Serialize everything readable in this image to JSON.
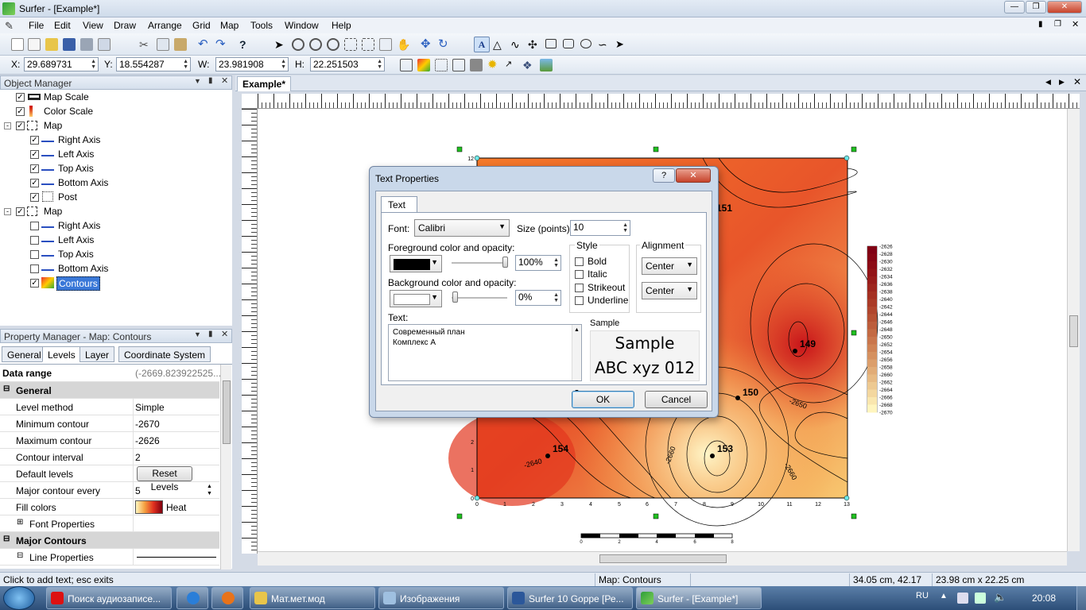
{
  "window": {
    "title": "Surfer - [Example*]"
  },
  "menu": [
    "File",
    "Edit",
    "View",
    "Draw",
    "Arrange",
    "Grid",
    "Map",
    "Tools",
    "Window",
    "Help"
  ],
  "coords": {
    "x_label": "X:",
    "x": "29.689731",
    "y_label": "Y:",
    "y": "18.554287",
    "w_label": "W:",
    "w": "23.981908",
    "h_label": "H:",
    "h": "22.251503"
  },
  "object_manager": {
    "title": "Object Manager",
    "items": [
      "Map Scale",
      "Color Scale",
      "Map",
      "Right Axis",
      "Left Axis",
      "Top Axis",
      "Bottom Axis",
      "Post",
      "Map",
      "Right Axis",
      "Left Axis",
      "Top Axis",
      "Bottom Axis",
      "Contours"
    ]
  },
  "property_manager": {
    "title": "Property Manager - Map: Contours",
    "tabs": [
      "General",
      "Levels",
      "Layer",
      "Coordinate System"
    ],
    "data_range_label": "Data range",
    "data_range": "(-2669.823922525...",
    "general": "General",
    "rows": [
      {
        "k": "Level method",
        "v": "Simple"
      },
      {
        "k": "Minimum contour",
        "v": "-2670"
      },
      {
        "k": "Maximum contour",
        "v": "-2626"
      },
      {
        "k": "Contour interval",
        "v": "2"
      },
      {
        "k": "Default levels",
        "v": "Reset Levels"
      },
      {
        "k": "Major contour every",
        "v": "5"
      },
      {
        "k": "Fill colors",
        "v": "Heat"
      },
      {
        "k": "Font Properties",
        "v": ""
      }
    ],
    "major": "Major Contours",
    "line_props": "Line Properties"
  },
  "doc": {
    "tab": "Example*"
  },
  "map": {
    "x_ticks": [
      "0",
      "1",
      "2",
      "3",
      "4",
      "5",
      "6",
      "7",
      "8",
      "9",
      "10",
      "11",
      "12",
      "13"
    ],
    "y_ticks": [
      "0",
      "1",
      "2",
      "12"
    ],
    "labels": [
      {
        "t": "151"
      },
      {
        "t": "149"
      },
      {
        "t": "150"
      },
      {
        "t": "154"
      },
      {
        "t": "153"
      }
    ],
    "contour_labels": [
      "-2650",
      "-2640",
      "-2660",
      "-2660"
    ],
    "scale_ticks": [
      "0",
      "2",
      "4",
      "6",
      "8"
    ],
    "colorscale": [
      "-2626",
      "-2628",
      "-2630",
      "-2632",
      "-2634",
      "-2636",
      "-2638",
      "-2640",
      "-2642",
      "-2644",
      "-2646",
      "-2648",
      "-2650",
      "-2652",
      "-2654",
      "-2656",
      "-2658",
      "-2660",
      "-2662",
      "-2664",
      "-2666",
      "-2668",
      "-2670"
    ]
  },
  "dialog": {
    "title": "Text Properties",
    "tab": "Text",
    "font_label": "Font:",
    "font": "Calibri",
    "size_label": "Size (points):",
    "size": "10",
    "fg_label": "Foreground color and opacity:",
    "fg_opacity": "100%",
    "bg_label": "Background color and opacity:",
    "bg_opacity": "0%",
    "style_label": "Style",
    "styles": [
      "Bold",
      "Italic",
      "Strikeout",
      "Underline"
    ],
    "alignment_label": "Alignment",
    "align_h": "Center",
    "align_v": "Center",
    "text_label": "Text:",
    "text_line1": "Современный план",
    "text_line2": "Комплекс А",
    "sample_label": "Sample",
    "sample_line1": "Sample",
    "sample_line2": "ABC xyz 012",
    "ok": "OK",
    "cancel": "Cancel"
  },
  "status": {
    "hint": "Click to add text; esc exits",
    "selection": "Map: Contours",
    "pos": "34.05 cm, 42.17 cm",
    "size": "23.98 cm x 22.25 cm"
  },
  "taskbar": {
    "tasks": [
      "Поиск аудиозаписе...",
      "",
      "Мат.мет.мод",
      "Изображения",
      "Surfer 10 Goppe [Ре...",
      "Surfer - [Example*]"
    ],
    "lang": "RU",
    "time": "20:08"
  }
}
